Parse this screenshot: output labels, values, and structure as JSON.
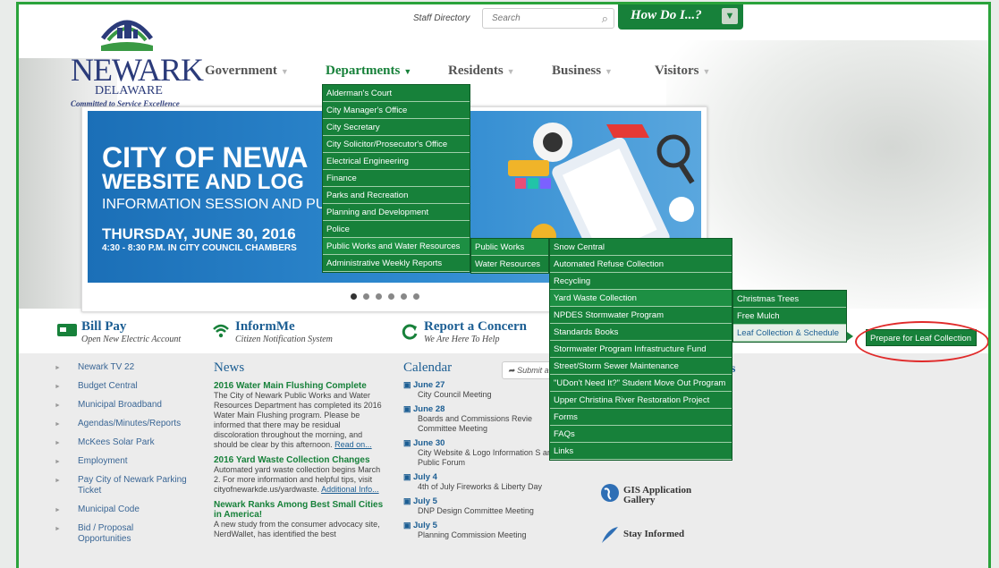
{
  "header": {
    "logo_name": "NEWARK",
    "logo_state": "DELAWARE",
    "logo_tagline": "Committed to Service Excellence",
    "staff_directory": "Staff Directory",
    "search_placeholder": "Search",
    "how_do_i": "How Do I...?"
  },
  "nav": [
    {
      "label": "Government"
    },
    {
      "label": "Departments"
    },
    {
      "label": "Residents"
    },
    {
      "label": "Business"
    },
    {
      "label": "Visitors"
    }
  ],
  "banner": {
    "line1": "CITY OF NEWA",
    "line2": "WEBSITE AND LOG",
    "line3": "INFORMATION SESSION AND PU",
    "line4": "THURSDAY, JUNE 30, 2016",
    "line5": "4:30 - 8:30 P.M. IN CITY COUNCIL CHAMBERS",
    "slide_count": 6,
    "active_slide": 1
  },
  "quick_links": [
    {
      "title": "Bill Pay",
      "sub": "Open New Electric Account"
    },
    {
      "title": "InformMe",
      "sub": "Citizen Notification System"
    },
    {
      "title": "Report a Concern",
      "sub": "We Are Here To Help"
    }
  ],
  "sidebar": [
    "Newark TV 22",
    "Budget Central",
    "Municipal Broadband",
    "Agendas/Minutes/Reports",
    "McKees Solar Park",
    "Employment",
    "Pay City of Newark Parking Ticket",
    "Municipal Code",
    "Bid / Proposal Opportunities"
  ],
  "news": {
    "heading": "News",
    "items": [
      {
        "headline": "2016 Water Main Flushing Complete",
        "body": "The City of Newark Public Works and Water Resources Department has completed its 2016 Water Main Flushing program. Please be informed that there may be residual discoloration throughout the morning, and should be clear by this afternoon.",
        "link": "Read on..."
      },
      {
        "headline": "2016 Yard Waste Collection Changes",
        "body": "Automated yard waste collection begins March 2. For more information and helpful tips, visit cityofnewarkde.us/yardwaste.",
        "link": "Additional Info..."
      },
      {
        "headline": "Newark Ranks Among Best Small Cities in America!",
        "body": "A new study from the consumer advocacy site, NerdWallet, has identified the best",
        "link": ""
      }
    ]
  },
  "calendar": {
    "heading": "Calendar",
    "submit_label": "Submit a",
    "events": [
      {
        "date": "June 27",
        "title": "City Council Meeting"
      },
      {
        "date": "June 28",
        "title": "Boards and Commissions Revie Committee Meeting"
      },
      {
        "date": "June 30",
        "title": "City Website & Logo Information S and Public Forum"
      },
      {
        "date": "July 4",
        "title": "4th of July Fireworks & Liberty Day"
      },
      {
        "date": "July 5",
        "title": "DNP Design Committee Meeting"
      },
      {
        "date": "July 5",
        "title": "Planning Commission Meeting"
      }
    ]
  },
  "right_links": {
    "partial_heading": "s",
    "gis": "GIS Application Gallery",
    "stay": "Stay Informed"
  },
  "departments_menu": [
    "Alderman's Court",
    "City Manager's Office",
    "City Secretary",
    "City Solicitor/Prosecutor's Office",
    "Electrical Engineering",
    "Finance",
    "Parks and Recreation",
    "Planning and Development",
    "Police",
    "Public Works and Water Resources",
    "Administrative Weekly Reports"
  ],
  "public_works_menu": [
    "Public Works",
    "Water Resources"
  ],
  "services_menu": [
    "Snow Central",
    "Automated Refuse Collection",
    "Recycling",
    "Yard Waste Collection",
    "NPDES Stormwater Program",
    "Standards Books",
    "Stormwater Program Infrastructure Fund",
    "Street/Storm Sewer Maintenance",
    "\"UDon't Need It?\" Student Move Out Program",
    "Upper Christina River Restoration Project",
    "Forms",
    "FAQs",
    "Links"
  ],
  "yard_menu": [
    "Christmas Trees",
    "Free Mulch",
    "Leaf Collection & Schedule"
  ],
  "popout": "Prepare for Leaf Collection",
  "colors": {
    "brand_green": "#17813a",
    "link_blue": "#1c5e93",
    "highlight_red": "#e02a2a"
  }
}
